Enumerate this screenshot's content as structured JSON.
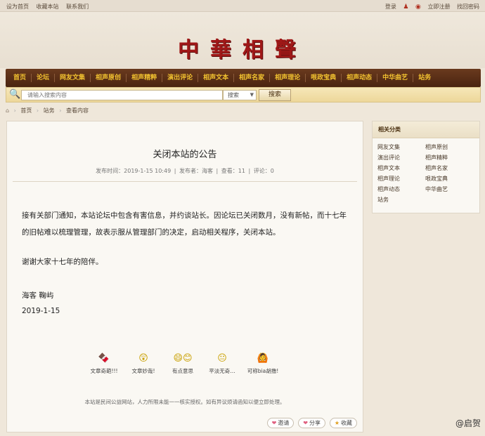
{
  "topbar": {
    "left_links": [
      "设为首页",
      "收藏本站",
      "联系我们"
    ],
    "right_links": [
      "登录",
      "立即注册",
      "找回密码"
    ]
  },
  "logo": "中華相聲",
  "nav": [
    "首页",
    "论坛",
    "网友文集",
    "相声原创",
    "相声精粹",
    "演出评论",
    "相声文本",
    "相声名家",
    "相声理论",
    "哏政宝典",
    "相声动态",
    "中华曲艺",
    "站务"
  ],
  "search": {
    "placeholder": "请输入搜索内容",
    "select_value": "搜索",
    "button": "搜索"
  },
  "breadcrumb": [
    "首页",
    "站务",
    "查看内容"
  ],
  "article": {
    "title": "关闭本站的公告",
    "meta_time_label": "发布时间：2019-1-15 10:49",
    "meta_author": "发布者：海客",
    "meta_views": "查看：11",
    "meta_comments": "评论：0",
    "para1": "接有关部门通知，本站论坛中包含有害信息，并约谈站长。因论坛已关闭数月，没有新帖，而十七年的旧帖难以梳理管理，故表示服从管理部门的决定，启动相关程序，关闭本站。",
    "para2": "谢谢大家十七年的陪伴。",
    "signature": "海客 鞠屿",
    "date": "2019-1-15",
    "reactions": [
      {
        "label": "文章奇葩!!!",
        "icon": "🍫"
      },
      {
        "label": "文章妙哉!",
        "icon": "😲"
      },
      {
        "label": "有点意思",
        "icon": "😄😊"
      },
      {
        "label": "平淡无奇…",
        "icon": "😐"
      },
      {
        "label": "可称bia胡撸!",
        "icon": "🙆"
      }
    ],
    "notice": "本站是民间公益网站，人力所限未能一一核实授权。如有异议烦请函知以便立即处理。",
    "actions": [
      "邀请",
      "分享",
      "收藏"
    ]
  },
  "sidebar": {
    "title": "相关分类",
    "items": [
      "网友文集",
      "相声原创",
      "演出评论",
      "相声精粹",
      "相声文本",
      "相声名家",
      "相声理论",
      "哏政宝典",
      "相声动态",
      "中华曲艺",
      "站务"
    ]
  },
  "watermark": "@启贺"
}
